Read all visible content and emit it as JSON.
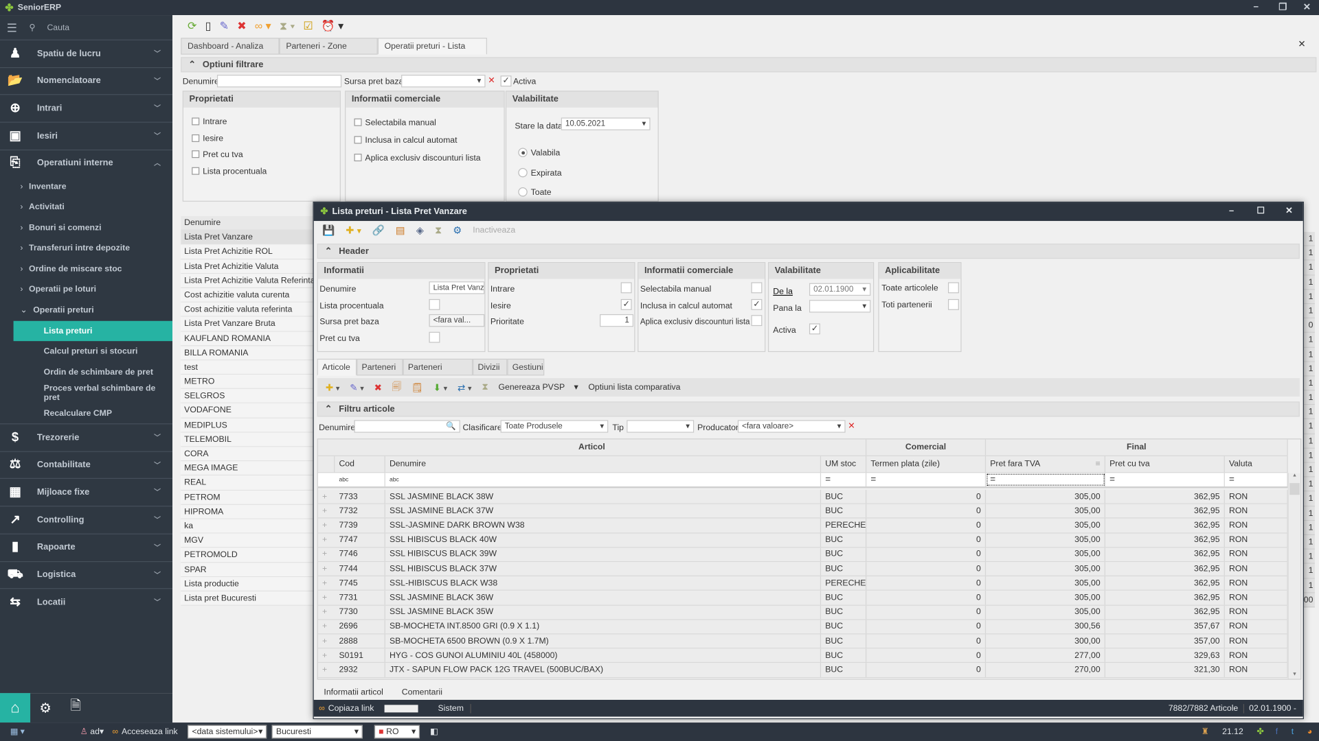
{
  "app": {
    "title": "SeniorERP",
    "search_placeholder": "Cauta"
  },
  "sidebar": {
    "items": [
      {
        "label": "Spatiu de lucru",
        "icon": "desk-user-icon",
        "glyph": "♟",
        "expanded": false
      },
      {
        "label": "Nomenclatoare",
        "icon": "folder-open-icon",
        "glyph": "📂",
        "expanded": false
      },
      {
        "label": "Intrari",
        "icon": "cart-add-icon",
        "glyph": "⊕",
        "expanded": false
      },
      {
        "label": "Iesiri",
        "icon": "cart-out-icon",
        "glyph": "▣",
        "expanded": false
      },
      {
        "label": "Operatiuni interne",
        "icon": "internal-ops-icon",
        "glyph": "⎘",
        "expanded": true
      }
    ],
    "subitems": [
      "Inventare",
      "Activitati",
      "Bonuri si comenzi",
      "Transferuri intre depozite",
      "Ordine de miscare stoc",
      "Operatii pe loturi",
      "Operatii preturi"
    ],
    "subsubitems": [
      "Lista preturi",
      "Calcul preturi si stocuri",
      "Ordin de schimbare de pret",
      "Proces verbal schimbare de  pret",
      "Recalculare CMP"
    ],
    "selected": "Lista preturi",
    "items_bottom": [
      {
        "label": "Trezorerie",
        "icon": "treasury-icon",
        "glyph": "$"
      },
      {
        "label": "Contabilitate",
        "icon": "balance-scale-icon",
        "glyph": "⚖"
      },
      {
        "label": "Mijloace fixe",
        "icon": "building-icon",
        "glyph": "▦"
      },
      {
        "label": "Controlling",
        "icon": "line-chart-icon",
        "glyph": "↗"
      },
      {
        "label": "Rapoarte",
        "icon": "bar-chart-icon",
        "glyph": "▮"
      },
      {
        "label": "Logistica",
        "icon": "truck-icon",
        "glyph": "⛟"
      },
      {
        "label": "Locatii",
        "icon": "directions-icon",
        "glyph": "⇆"
      }
    ],
    "accent": "#26b3a3"
  },
  "taskbar": {
    "user": "ad",
    "access_link": "Acceseaza link",
    "date_select": "<data sistemului>",
    "location_select": "Bucuresti",
    "language": "RO",
    "version": "21.12"
  },
  "main": {
    "tabs": [
      "Dashboard - Analiza Stoc",
      "Parteneri - Zone vanzare",
      "Operatii preturi - Lista preturi"
    ],
    "active_tab": 2,
    "filter_section": "Optiuni filtrare",
    "filter": {
      "denumire_label": "Denumire",
      "denumire_value": "",
      "sursa_label": "Sursa pret baza",
      "sursa_value": "",
      "activa_label": "Activa",
      "activa_checked": true
    },
    "groups": {
      "proprietati": {
        "title": "Proprietati",
        "items": [
          "Intrare",
          "Iesire",
          "Pret cu tva",
          "Lista procentuala"
        ]
      },
      "info_comerciale": {
        "title": "Informatii comerciale",
        "items": [
          "Selectabila manual",
          "Inclusa in calcul automat",
          "Aplica exclusiv discounturi lista"
        ]
      },
      "valabilitate": {
        "title": "Valabilitate",
        "date_label": "Stare la data",
        "date_value": "10.05.2021",
        "options": [
          "Valabila",
          "Expirata",
          "Toate"
        ],
        "selected": "Valabila"
      }
    },
    "list_header": "Denumire",
    "list": [
      "Lista Pret Vanzare",
      "Lista Pret Achizitie ROL",
      "Lista Pret Achizitie Valuta",
      "Lista Pret Achizitie Valuta Referinta",
      "Cost achizitie valuta curenta",
      "Cost achizitie valuta referinta",
      "Lista Pret Vanzare Bruta",
      "KAUFLAND ROMANIA",
      "BILLA ROMANIA",
      "test",
      "METRO",
      "SELGROS",
      "VODAFONE",
      "MEDIPLUS",
      "TELEMOBIL",
      "CORA",
      "MEGA IMAGE",
      "REAL",
      "PETROM",
      "HIPROMA",
      "ka",
      "MGV",
      "PETROMOLD",
      "SPAR",
      "Lista productie",
      "Lista pret Bucuresti"
    ],
    "list_right_values": [
      "1",
      "1",
      "1",
      "1",
      "1",
      "1",
      "0",
      "1",
      "1",
      "1",
      "1",
      "1",
      "1",
      "1",
      "1",
      "1",
      "1",
      "1",
      "1",
      "1",
      "1",
      "1",
      "1",
      "1",
      "1",
      "00"
    ]
  },
  "dialog": {
    "title": "Lista preturi - Lista Pret Vanzare",
    "inactivate_label": "Inactiveaza",
    "header_section": "Header",
    "informatii": {
      "title": "Informatii",
      "denumire_label": "Denumire",
      "denumire_value": "Lista Pret Vanz",
      "procentuala_label": "Lista procentuala",
      "procentuala": false,
      "sursa_label": "Sursa pret baza",
      "sursa_value": "<fara val...",
      "tva_label": "Pret cu tva",
      "tva": false
    },
    "proprietati": {
      "title": "Proprietati",
      "intrare_label": "Intrare",
      "intrare": false,
      "iesire_label": "Iesire",
      "iesire": true,
      "prioritate_label": "Prioritate",
      "prioritate_value": "1"
    },
    "info_comerciale": {
      "title": "Informatii comerciale",
      "selectabila_label": "Selectabila manual",
      "selectabila": false,
      "inclusa_label": "Inclusa in calcul automat",
      "inclusa": true,
      "aplica_label": "Aplica exclusiv discounturi lista",
      "aplica": false
    },
    "valabilitate": {
      "title": "Valabilitate",
      "de_la_label": "De la",
      "de_la_value": "02.01.1900",
      "pana_la_label": "Pana la",
      "pana_la_value": "",
      "activa_label": "Activa",
      "activa": true
    },
    "aplicabilitate": {
      "title": "Aplicabilitate",
      "toate_label": "Toate articolele",
      "toate": false,
      "toti_label": "Toti partenerii",
      "toti": false
    },
    "tabs": [
      "Articole",
      "Parteneri",
      "Parteneri interzisi",
      "Divizii",
      "Gestiuni"
    ],
    "active_tab": 0,
    "toolbar": {
      "genereaza": "Genereaza PVSP",
      "optiuni": "Optiuni lista comparativa"
    },
    "filtru_section": "Filtru articole",
    "filtru": {
      "denumire_label": "Denumire",
      "denumire_value": "",
      "clasificare_label": "Clasificare",
      "clasificare_value": "Toate Produsele",
      "tip_label": "Tip",
      "tip_value": "",
      "producator_label": "Producator",
      "producator_value": "<fara valoare>"
    },
    "grid": {
      "bands": [
        "Articol",
        "Comercial",
        "Final"
      ],
      "columns": [
        "Cod",
        "Denumire",
        "UM stoc",
        "Termen plata (zile)",
        "Pret fara TVA",
        "Pret cu tva",
        "Valuta"
      ],
      "filter_row": [
        "abc",
        "abc",
        "=",
        "=",
        "=",
        "=",
        "="
      ],
      "rows": [
        [
          "7733",
          "SSL JASMINE BLACK 38W",
          "BUC",
          "0",
          "305,00",
          "362,95",
          "RON"
        ],
        [
          "7732",
          "SSL JASMINE BLACK 37W",
          "BUC",
          "0",
          "305,00",
          "362,95",
          "RON"
        ],
        [
          "7739",
          "SSL-JASMINE DARK BROWN W38",
          "PERECHE",
          "0",
          "305,00",
          "362,95",
          "RON"
        ],
        [
          "7747",
          "SSL HIBISCUS BLACK 40W",
          "BUC",
          "0",
          "305,00",
          "362,95",
          "RON"
        ],
        [
          "7746",
          "SSL HIBISCUS BLACK 39W",
          "BUC",
          "0",
          "305,00",
          "362,95",
          "RON"
        ],
        [
          "7744",
          "SSL HIBISCUS BLACK 37W",
          "BUC",
          "0",
          "305,00",
          "362,95",
          "RON"
        ],
        [
          "7745",
          "SSL-HIBISCUS BLACK W38",
          "PERECHE",
          "0",
          "305,00",
          "362,95",
          "RON"
        ],
        [
          "7731",
          "SSL JASMINE BLACK 36W",
          "BUC",
          "0",
          "305,00",
          "362,95",
          "RON"
        ],
        [
          "7730",
          "SSL JASMINE BLACK 35W",
          "BUC",
          "0",
          "305,00",
          "362,95",
          "RON"
        ],
        [
          "2696",
          "SB-MOCHETA INT.8500 GRI (0.9 X 1.1)",
          "BUC",
          "0",
          "300,56",
          "357,67",
          "RON"
        ],
        [
          "2888",
          "SB-MOCHETA 6500 BROWN (0.9 X 1.7M)",
          "BUC",
          "0",
          "300,00",
          "357,00",
          "RON"
        ],
        [
          "S0191",
          "HYG - COS GUNOI ALUMINIU  40L (458000)",
          "BUC",
          "0",
          "277,00",
          "329,63",
          "RON"
        ],
        [
          "2932",
          "JTX - SAPUN FLOW PACK 12G TRAVEL (500BUC/BAX)",
          "BUC",
          "0",
          "270,00",
          "321,30",
          "RON"
        ]
      ]
    },
    "bottom_tabs": [
      "Informatii articol",
      "Comentarii"
    ],
    "status": {
      "copy_link": "Copiaza link",
      "system": "Sistem",
      "count": "7882/7882 Articole",
      "date": "02.01.1900 -"
    }
  }
}
